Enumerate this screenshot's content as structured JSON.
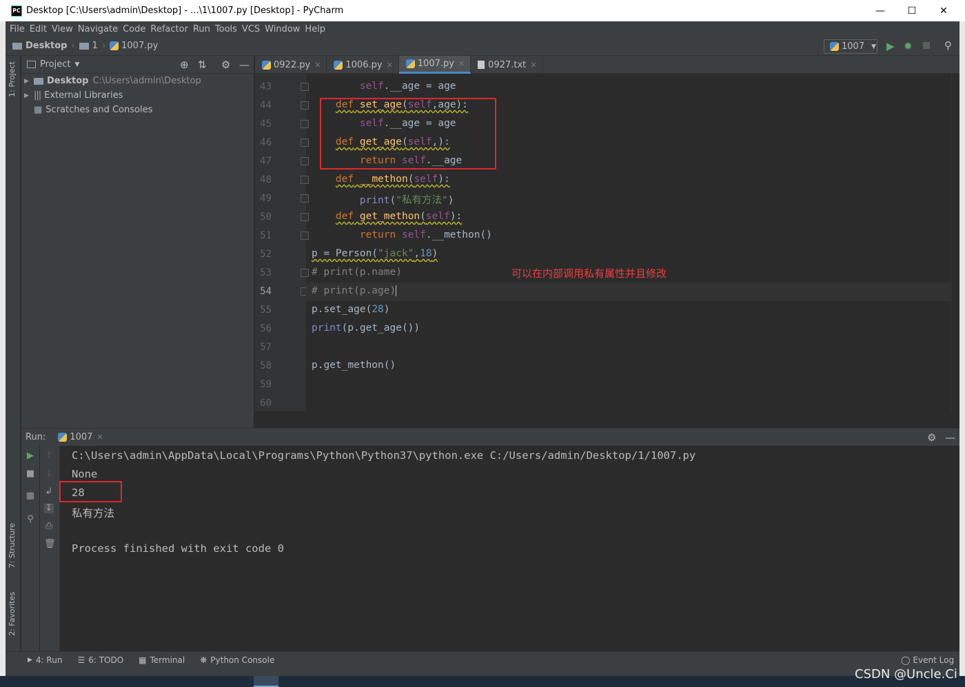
{
  "window": {
    "title": "Desktop [C:\\Users\\admin\\Desktop] - ...\\1\\1007.py [Desktop] - PyCharm"
  },
  "menu": [
    "File",
    "Edit",
    "View",
    "Navigate",
    "Code",
    "Refactor",
    "Run",
    "Tools",
    "VCS",
    "Window",
    "Help"
  ],
  "breadcrumb": {
    "root": "Desktop",
    "folder": "1",
    "file": "1007.py"
  },
  "run_config": {
    "name": "1007"
  },
  "project": {
    "header": "Project",
    "items": [
      {
        "label": "Desktop",
        "path": "C:\\Users\\admin\\Desktop"
      },
      {
        "label": "External Libraries"
      },
      {
        "label": "Scratches and Consoles"
      }
    ]
  },
  "side_tabs": {
    "project": "1: Project",
    "structure": "7: Structure",
    "favorites": "2: Favorites"
  },
  "tabs": [
    "0922.py",
    "1006.py",
    "1007.py",
    "0927.txt"
  ],
  "editor": {
    "line_numbers": [
      "43",
      "44",
      "45",
      "46",
      "47",
      "48",
      "49",
      "50",
      "51",
      "52",
      "53",
      "54",
      "55",
      "56",
      "57",
      "58",
      "59",
      "60"
    ],
    "annotation": "可以在内部调用私有属性并且修改"
  },
  "run": {
    "label": "Run:",
    "tab": "1007",
    "output": [
      "C:\\Users\\admin\\AppData\\Local\\Programs\\Python\\Python37\\python.exe C:/Users/admin/Desktop/1/1007.py",
      "None",
      "28",
      "私有方法",
      "",
      "Process finished with exit code 0"
    ]
  },
  "bottom_tabs": [
    "4: Run",
    "6: TODO",
    "Terminal",
    "Python Console"
  ],
  "event_log": "Event Log",
  "watermark": "CSDN @Uncle.Ci",
  "colors": {
    "accent": "#4a88c7",
    "highlight_box": "#e0282e",
    "annotation": "#f03c3c"
  }
}
